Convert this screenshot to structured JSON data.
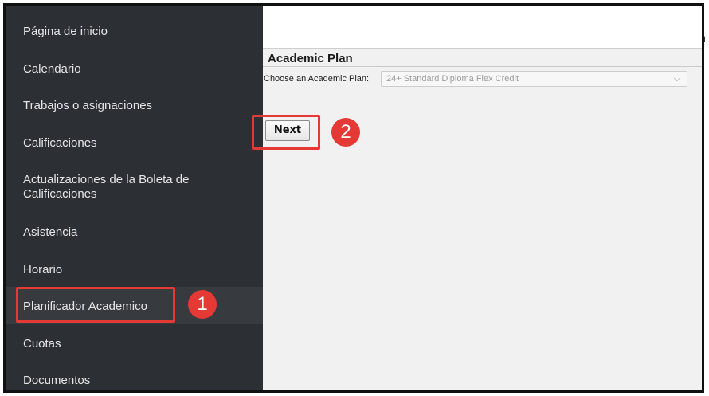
{
  "sidebar": {
    "cutoff_char": "n",
    "items": [
      {
        "label": "Página de inicio"
      },
      {
        "label": "Calendario"
      },
      {
        "label": "Trabajos o asignaciones"
      },
      {
        "label": "Calificaciones"
      },
      {
        "label": "Actualizaciones de la Boleta de",
        "label2": "Calificaciones"
      },
      {
        "label": "Asistencia"
      },
      {
        "label": "Horario"
      },
      {
        "label": "Planificador Academico"
      },
      {
        "label": "Cuotas"
      },
      {
        "label": "Documentos"
      }
    ]
  },
  "main": {
    "section_title": "Academic Plan",
    "plan_label": "Choose an Academic Plan:",
    "plan_value": "24+ Standard Diploma Flex Credit",
    "next_label": "Next"
  },
  "annotations": {
    "badge1": "1",
    "badge2": "2",
    "color": "#e53935"
  }
}
